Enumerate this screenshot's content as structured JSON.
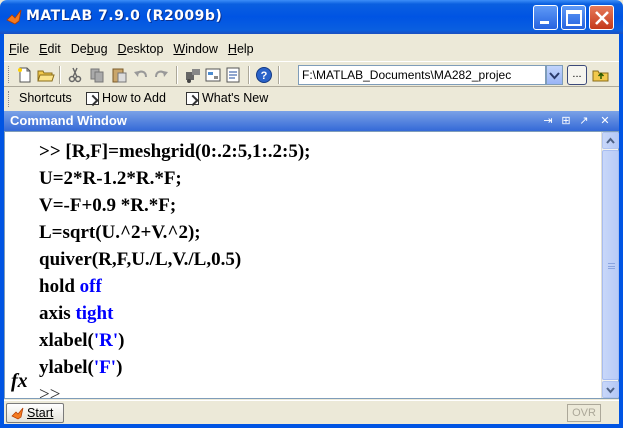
{
  "window": {
    "title": "MATLAB  7.9.0 (R2009b)",
    "minimize_icon": "minimize-icon",
    "maximize_icon": "maximize-icon",
    "close_icon": "close-icon"
  },
  "menu": {
    "items": [
      {
        "u": "F",
        "rest": "ile"
      },
      {
        "u": "E",
        "rest": "dit"
      },
      {
        "pre": "De",
        "u": "b",
        "rest": "ug"
      },
      {
        "u": "D",
        "rest": "esktop"
      },
      {
        "u": "W",
        "rest": "indow"
      },
      {
        "u": "H",
        "rest": "elp"
      }
    ]
  },
  "toolbar": {
    "icons": [
      "new-file-icon",
      "open-folder-icon",
      "cut-icon",
      "copy-icon",
      "paste-icon",
      "undo-icon",
      "redo-icon",
      "simulink-icon",
      "guide-icon",
      "profiler-icon",
      "help-icon"
    ],
    "current_folder": "F:\\MATLAB_Documents\\MA282_projec",
    "browse_label": "..."
  },
  "shortcuts": {
    "label": "Shortcuts",
    "items": [
      "How to Add",
      "What's New"
    ]
  },
  "command_window": {
    "title": "Command Window",
    "lines": [
      ">> [R,F]=meshgrid(0:.2:5,1:.2:5);",
      "U=2*R-1.2*R.*F;",
      "V=-F+0.9 *R.*F;",
      "L=sqrt(U.^2+V.^2);",
      "quiver(R,F,U./L,V./L,0.5)",
      "hold ",
      "off",
      "axis ",
      "tight",
      "xlabel(",
      "'R'",
      ")",
      "ylabel(",
      "'F'",
      ")"
    ],
    "prompt": ">>",
    "fx_label": "fx"
  },
  "status": {
    "start_label": "Start",
    "ovr_label": "OVR"
  }
}
